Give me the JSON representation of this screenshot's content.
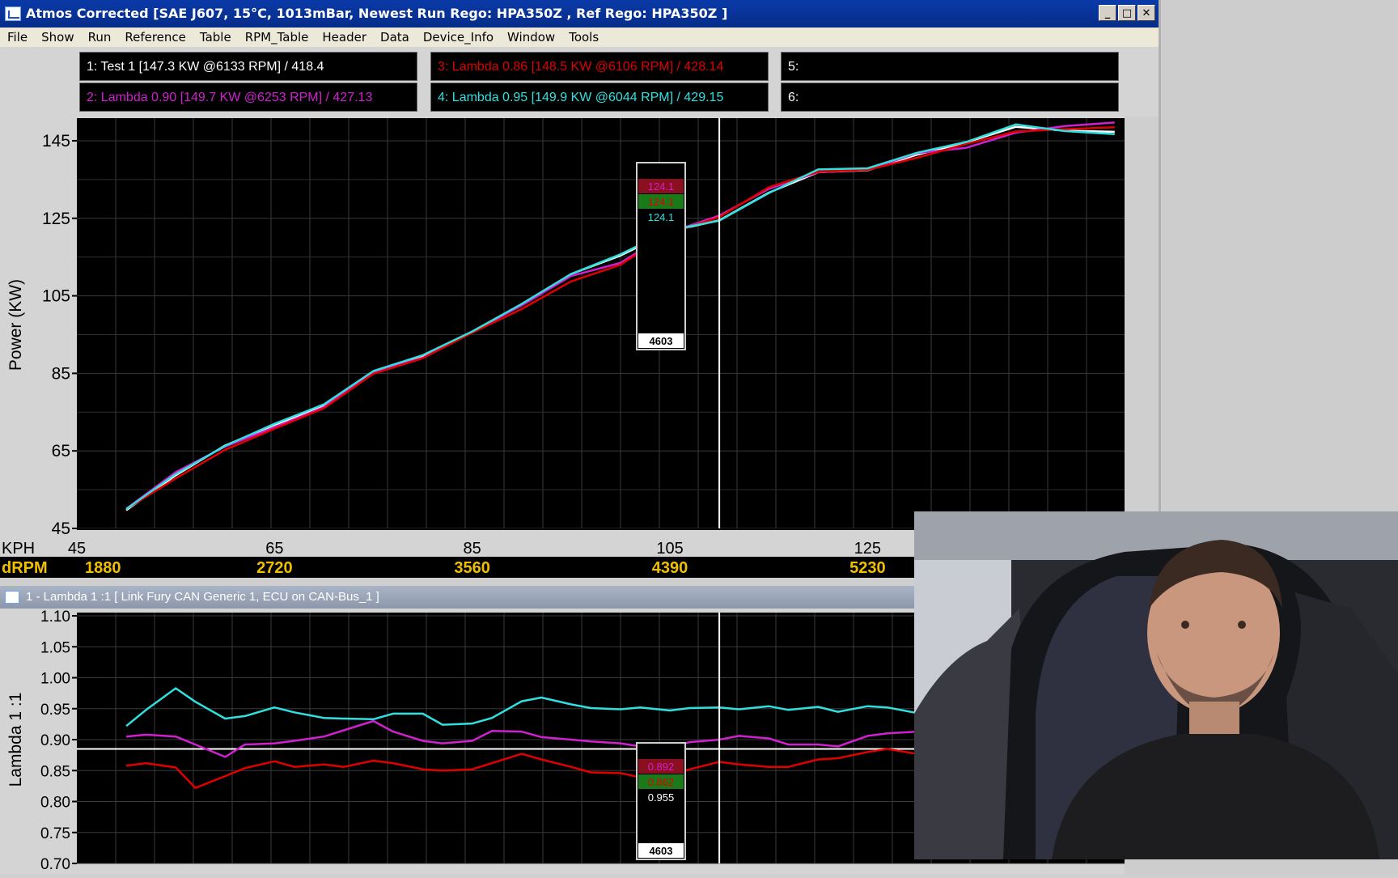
{
  "window": {
    "title": "Atmos Corrected [SAE J607, 15°C, 1013mBar,  Newest Run Rego: HPA350Z ,  Ref Rego: HPA350Z ]",
    "buttons": {
      "minimize": "_",
      "maximize": "□",
      "close": "✕"
    }
  },
  "menu": [
    "File",
    "Show",
    "Run",
    "Reference",
    "Table",
    "RPM_Table",
    "Header",
    "Data",
    "Device_Info",
    "Window",
    "Tools"
  ],
  "legend": [
    {
      "text": "1:    Test 1 [147.3 KW @6133 RPM] / 418.4",
      "color": "#ffffff"
    },
    {
      "text": "3:    Lambda 0.86 [148.5 KW @6106 RPM] / 428.14",
      "color": "#e00000"
    },
    {
      "text": "5:",
      "color": "#ffffff"
    },
    {
      "text": "2:    Lambda 0.90 [149.7 KW @6253 RPM] / 427.13",
      "color": "#d020d0"
    },
    {
      "text": "4:    Lambda 0.95 [149.9 KW @6044 RPM] / 429.15",
      "color": "#30e0e0"
    },
    {
      "text": "6:",
      "color": "#ffffff"
    }
  ],
  "chart_data": [
    {
      "type": "line",
      "ylabel": "Power (KW)",
      "xlabel": "KPH",
      "xlim": [
        45,
        151
      ],
      "ylim": [
        45,
        150
      ],
      "y_ticks": [
        "145",
        "125",
        "105",
        "85",
        "65",
        "45"
      ],
      "x_ticks": [
        "45",
        "65",
        "85",
        "105",
        "125"
      ],
      "cursor_x": 110,
      "grid": true,
      "series": [
        {
          "name": "Test 1",
          "color": "#ffffff",
          "x": [
            50,
            55,
            60,
            65,
            70,
            75,
            80,
            85,
            90,
            95,
            100,
            105,
            110,
            115,
            120,
            125,
            130,
            135,
            140,
            145,
            150
          ],
          "y": [
            49.7,
            58.7,
            66.4,
            71.7,
            76.6,
            85.3,
            89.3,
            95.7,
            102.6,
            110.6,
            115.4,
            121.6,
            124.5,
            131.6,
            136.9,
            137.4,
            141.4,
            144.6,
            148.6,
            147.6,
            147.3
          ]
        },
        {
          "name": "Lambda 0.90",
          "color": "#d020d0",
          "x": [
            50,
            55,
            60,
            65,
            70,
            75,
            80,
            85,
            90,
            95,
            100,
            105,
            110,
            115,
            120,
            125,
            130,
            135,
            140,
            145,
            150
          ],
          "y": [
            50.1,
            59.5,
            66.1,
            71.1,
            76.3,
            85.4,
            89.0,
            95.8,
            102.5,
            110.1,
            113.5,
            121.4,
            125.7,
            132.6,
            136.9,
            137.5,
            141.8,
            143.2,
            147.1,
            148.8,
            149.7
          ]
        },
        {
          "name": "Lambda 0.86",
          "color": "#e00000",
          "x": [
            50,
            55,
            60,
            65,
            70,
            75,
            80,
            85,
            90,
            95,
            100,
            105,
            110,
            115,
            120,
            125,
            130,
            135,
            140,
            145,
            150
          ],
          "y": [
            50.0,
            57.9,
            65.3,
            70.7,
            76.0,
            84.9,
            88.9,
            95.5,
            101.6,
            108.7,
            113.0,
            121.2,
            125.3,
            133.0,
            137.0,
            137.5,
            140.6,
            144.2,
            147.4,
            148.0,
            148.5
          ]
        },
        {
          "name": "Lambda 0.95",
          "color": "#30e0e0",
          "x": [
            50,
            55,
            60,
            65,
            70,
            75,
            80,
            85,
            90,
            95,
            100,
            105,
            110,
            115,
            120,
            125,
            130,
            135,
            140,
            145,
            150
          ],
          "y": [
            50.0,
            59.0,
            66.3,
            72.0,
            77.0,
            85.6,
            89.7,
            95.8,
            102.9,
            110.6,
            115.7,
            121.9,
            124.4,
            131.5,
            137.6,
            137.9,
            141.9,
            144.7,
            149.2,
            147.5,
            146.7
          ]
        }
      ],
      "cursor_readout": {
        "values": [
          "124.1",
          "124.1",
          "124.1"
        ],
        "colors": [
          "#d020d0",
          "#e00000",
          "#30e0e0"
        ],
        "rpm": "4603"
      }
    },
    {
      "type": "line",
      "ylabel": "Lambda 1 :1",
      "xlim": [
        45,
        151
      ],
      "ylim": [
        0.7,
        1.1
      ],
      "y_ticks": [
        "1.10",
        "1.05",
        "1.00",
        "0.95",
        "0.90",
        "0.85",
        "0.80",
        "0.75",
        "0.70"
      ],
      "reference_line": 0.885,
      "cursor_x": 110,
      "grid": true,
      "series": [
        {
          "name": "Lambda 0.95",
          "color": "#30e0e0",
          "x": [
            50,
            52,
            55,
            57,
            60,
            62,
            65,
            67,
            70,
            72,
            75,
            77,
            80,
            82,
            85,
            87,
            90,
            92,
            95,
            97,
            100,
            102,
            105,
            107,
            110,
            112,
            115,
            117,
            120,
            122,
            125,
            127,
            130
          ],
          "y": [
            0.922,
            0.948,
            0.983,
            0.961,
            0.934,
            0.938,
            0.952,
            0.944,
            0.935,
            0.934,
            0.933,
            0.942,
            0.942,
            0.924,
            0.926,
            0.935,
            0.962,
            0.968,
            0.957,
            0.951,
            0.949,
            0.952,
            0.947,
            0.951,
            0.952,
            0.949,
            0.954,
            0.948,
            0.953,
            0.945,
            0.954,
            0.952,
            0.943
          ]
        },
        {
          "name": "Lambda 0.90",
          "color": "#d020d0",
          "x": [
            50,
            52,
            55,
            57,
            60,
            62,
            65,
            67,
            70,
            72,
            75,
            77,
            80,
            82,
            85,
            87,
            90,
            92,
            95,
            97,
            100,
            102,
            105,
            107,
            110,
            112,
            115,
            117,
            120,
            122,
            125,
            127,
            130
          ],
          "y": [
            0.905,
            0.908,
            0.905,
            0.892,
            0.872,
            0.892,
            0.894,
            0.898,
            0.905,
            0.915,
            0.93,
            0.913,
            0.898,
            0.894,
            0.898,
            0.914,
            0.913,
            0.904,
            0.9,
            0.897,
            0.894,
            0.889,
            0.887,
            0.896,
            0.9,
            0.906,
            0.902,
            0.892,
            0.892,
            0.889,
            0.906,
            0.91,
            0.913
          ]
        },
        {
          "name": "Lambda 0.86",
          "color": "#e00000",
          "x": [
            50,
            52,
            55,
            57,
            60,
            62,
            65,
            67,
            70,
            72,
            75,
            77,
            80,
            82,
            85,
            87,
            90,
            92,
            95,
            97,
            100,
            102,
            105,
            107,
            110,
            112,
            115,
            117,
            120,
            122,
            125,
            127,
            130
          ],
          "y": [
            0.858,
            0.862,
            0.855,
            0.822,
            0.841,
            0.854,
            0.865,
            0.856,
            0.86,
            0.856,
            0.866,
            0.862,
            0.852,
            0.85,
            0.852,
            0.862,
            0.877,
            0.868,
            0.856,
            0.847,
            0.846,
            0.839,
            0.844,
            0.852,
            0.864,
            0.86,
            0.856,
            0.856,
            0.868,
            0.87,
            0.88,
            0.885,
            0.877
          ]
        }
      ],
      "cursor_readout": {
        "values": [
          "0.892",
          "0.862",
          "0.955"
        ],
        "colors": [
          "#d020d0",
          "#e00000",
          "#ffffff"
        ],
        "rpm": "4603"
      }
    }
  ],
  "axis_strip": {
    "label": "KPH",
    "ticks": [
      "45",
      "65",
      "85",
      "105",
      "125"
    ]
  },
  "rpm_strip": {
    "label": "dRPM",
    "values": [
      "1880",
      "2720",
      "3560",
      "4390",
      "5230"
    ]
  },
  "subwindow": {
    "title": "1 - Lambda 1 :1     [ Link Fury CAN Generic 1, ECU on CAN-Bus_1 ]"
  },
  "webcam": {
    "icon": "person-video-icon"
  }
}
